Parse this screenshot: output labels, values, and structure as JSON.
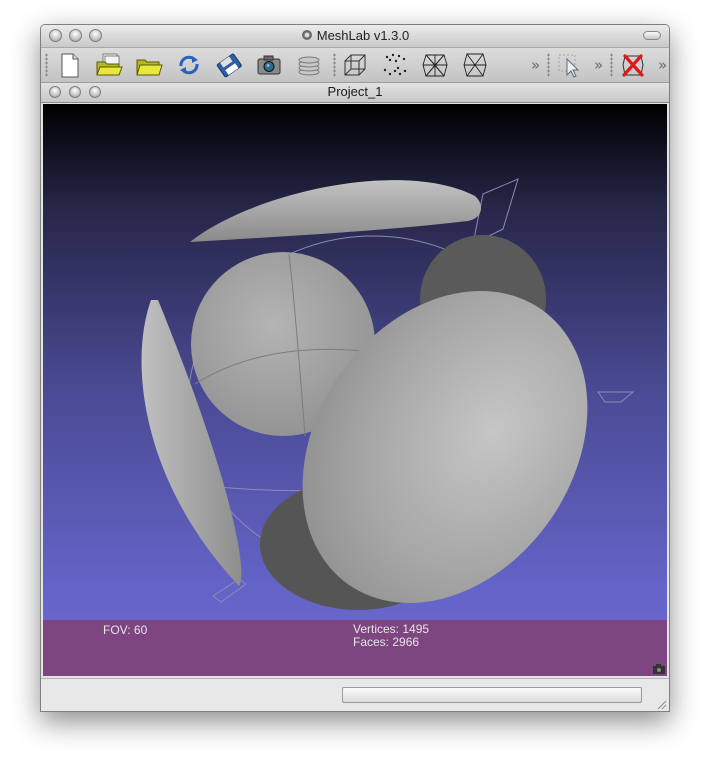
{
  "window": {
    "title": "MeshLab v1.3.0"
  },
  "document": {
    "title": "Project_1"
  },
  "toolbar": {
    "buttons": [
      {
        "name": "new-document-icon"
      },
      {
        "name": "open-project-icon"
      },
      {
        "name": "open-mesh-icon"
      },
      {
        "name": "reload-icon"
      },
      {
        "name": "save-icon"
      },
      {
        "name": "snapshot-camera-icon"
      },
      {
        "name": "show-layers-icon"
      },
      {
        "name": "bounding-box-icon"
      },
      {
        "name": "points-render-icon"
      },
      {
        "name": "wireframe-render-icon"
      },
      {
        "name": "hidden-lines-render-icon"
      },
      {
        "name": "select-pointer-icon"
      },
      {
        "name": "delete-icon"
      }
    ],
    "overflow_glyph": "»"
  },
  "viewport": {
    "fov_label": "FOV: 60",
    "vertices_label": "Vertices: 1495",
    "faces_label": "Faces: 2966"
  },
  "colors": {
    "info_bar": "#7e4680",
    "background_top": "#000000",
    "background_bottom": "#6c6cd2",
    "mesh": "#a3a3a3"
  }
}
